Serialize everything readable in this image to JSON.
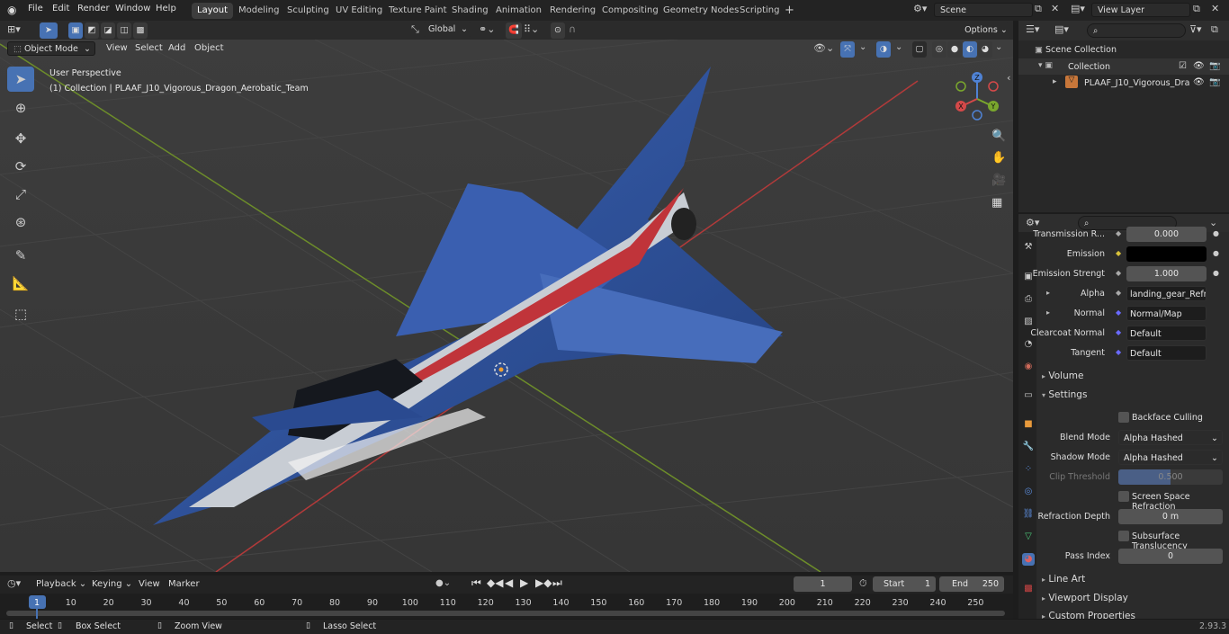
{
  "topbar": {
    "menus": [
      "File",
      "Edit",
      "Render",
      "Window",
      "Help"
    ],
    "workspaces": [
      "Layout",
      "Modeling",
      "Sculpting",
      "UV Editing",
      "Texture Paint",
      "Shading",
      "Animation",
      "Rendering",
      "Compositing",
      "Geometry Nodes",
      "Scripting"
    ],
    "add_tab": "+",
    "scene_name": "Scene",
    "view_layer": "View Layer"
  },
  "viewport_header": {
    "mode": "Object Mode",
    "menus": [
      "View",
      "Select",
      "Add",
      "Object"
    ],
    "transform_orientation": "Global",
    "options": "Options"
  },
  "viewport": {
    "perspective": "User Perspective",
    "collection_info": "(1) Collection | PLAAF_J10_Vigorous_Dragon_Aerobatic_Team",
    "gizmo": {
      "z": "Z",
      "y": "Y",
      "x": "X"
    }
  },
  "outliner": {
    "root": "Scene Collection",
    "collection": "Collection",
    "object": "PLAAF_J10_Vigorous_Dra"
  },
  "properties": {
    "rows": [
      {
        "label": "Transmission R...",
        "value": "0.000",
        "type": "num"
      },
      {
        "label": "Emission",
        "value": "",
        "type": "color"
      },
      {
        "label": "Emission Strengt",
        "value": "1.000",
        "type": "num"
      },
      {
        "label": "Alpha",
        "value": "landing_gear_Refrac...",
        "type": "link"
      },
      {
        "label": "Normal",
        "value": "Normal/Map",
        "type": "link"
      },
      {
        "label": "Clearcoat Normal",
        "value": "Default",
        "type": "link"
      },
      {
        "label": "Tangent",
        "value": "Default",
        "type": "link"
      }
    ],
    "volume": "Volume",
    "settings": "Settings",
    "backface_culling": "Backface Culling",
    "blend_mode_label": "Blend Mode",
    "blend_mode": "Alpha Hashed",
    "shadow_mode_label": "Shadow Mode",
    "shadow_mode": "Alpha Hashed",
    "clip_threshold_label": "Clip Threshold",
    "clip_threshold": "0.500",
    "screen_space_refraction": "Screen Space Refraction",
    "refraction_depth_label": "Refraction Depth",
    "refraction_depth": "0 m",
    "subsurface_translucency": "Subsurface Translucency",
    "pass_index_label": "Pass Index",
    "pass_index": "0",
    "line_art": "Line Art",
    "viewport_display": "Viewport Display",
    "custom_properties": "Custom Properties"
  },
  "timeline": {
    "menus": [
      "Playback",
      "Keying",
      "View",
      "Marker"
    ],
    "current_frame": "1",
    "start_label": "Start",
    "start": "1",
    "end_label": "End",
    "end": "250",
    "ticks": [
      "1",
      "10",
      "20",
      "30",
      "40",
      "50",
      "60",
      "70",
      "80",
      "90",
      "100",
      "110",
      "120",
      "130",
      "140",
      "150",
      "160",
      "170",
      "180",
      "190",
      "200",
      "210",
      "220",
      "230",
      "240",
      "250"
    ]
  },
  "statusbar": {
    "select": "Select",
    "box_select": "Box Select",
    "zoom_view": "Zoom View",
    "lasso_select": "Lasso Select",
    "version": "2.93.3"
  },
  "colors": {
    "accent": "#4772b3",
    "active_frame": "#4772b3",
    "x_axis": "#d44949",
    "y_axis": "#7aa72d",
    "z_axis": "#4f82d4"
  }
}
